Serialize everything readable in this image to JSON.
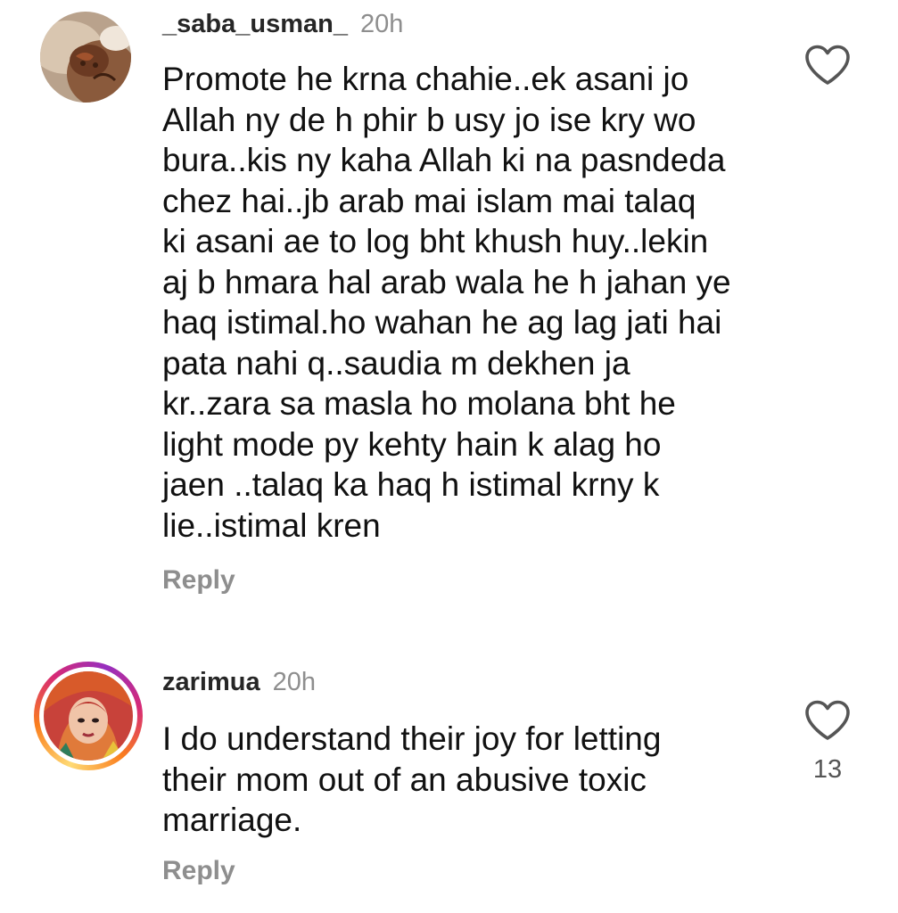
{
  "comments": [
    {
      "username": "_saba_usman_",
      "time": "20h",
      "text_lines": [
        "Promote he krna chahie..ek asani jo",
        "Allah ny de h phir b usy jo ise kry wo",
        "bura..kis ny kaha Allah ki na pasndeda",
        "chez hai..jb arab mai islam mai talaq",
        "ki asani ae to log bht khush huy..lekin",
        "aj b hmara hal arab wala he h jahan ye",
        "haq istimal.ho wahan he ag lag jati hai",
        "pata nahi q..saudia m dekhen ja",
        "kr..zara sa masla ho molana bht he",
        "light mode py kehty hain k alag ho",
        "jaen ..talaq ka haq h istimal krny k",
        "lie..istimal kren"
      ],
      "reply_label": "Reply",
      "like_icon": "heart-outline-icon",
      "likes": ""
    },
    {
      "username": "zarimua",
      "time": "20h",
      "text_lines": [
        "I do understand their joy for letting",
        "their mom out of an abusive toxic",
        "marriage."
      ],
      "reply_label": "Reply",
      "like_icon": "heart-outline-icon",
      "likes": "13",
      "story_ring": true
    }
  ],
  "colors": {
    "username": "#262626",
    "meta": "#8e8e8e",
    "body": "#111111",
    "story_ring": [
      "#feda75",
      "#fa7e1e",
      "#d62976",
      "#962fbf"
    ]
  }
}
